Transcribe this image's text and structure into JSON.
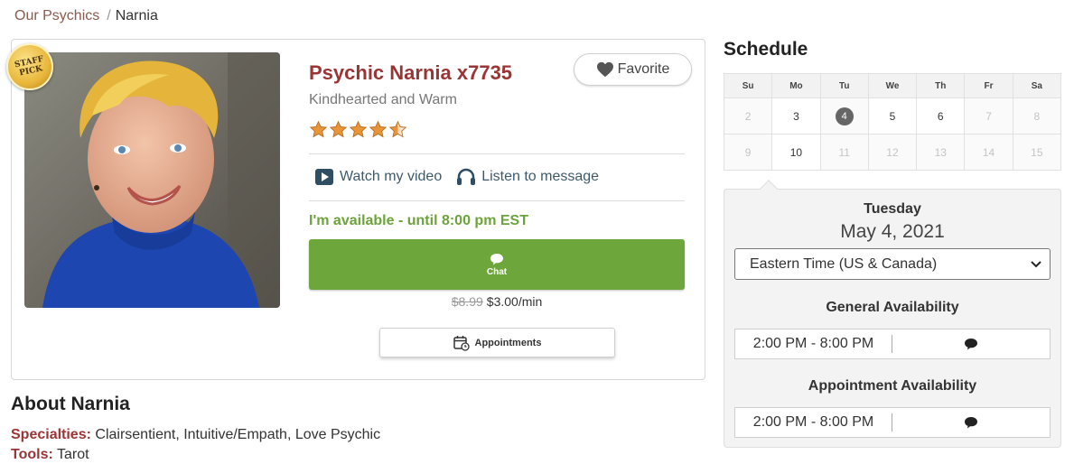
{
  "breadcrumb": {
    "parent": "Our Psychics",
    "separator": "/",
    "current": "Narnia"
  },
  "profile": {
    "badge": "STAFF\nPICK",
    "name": "Psychic Narnia x7735",
    "tagline": "Kindhearted and Warm",
    "rating": 4.5,
    "favorite_label": "Favorite",
    "watch_video_label": "Watch my video",
    "listen_message_label": "Listen to message",
    "availability_text": "I'm available - until 8:00 pm EST",
    "chat_label": "Chat",
    "old_price": "$8.99",
    "price": "$3.00/min",
    "appointments_label": "Appointments"
  },
  "about": {
    "title": "About Narnia",
    "specialties_label": "Specialties:",
    "specialties": "Clairsentient, Intuitive/Empath, Love Psychic",
    "tools_label": "Tools:",
    "tools": "Tarot"
  },
  "schedule": {
    "title": "Schedule",
    "weekdays": [
      "Su",
      "Mo",
      "Tu",
      "We",
      "Th",
      "Fr",
      "Sa"
    ],
    "week1": [
      "2",
      "3",
      "4",
      "5",
      "6",
      "7",
      "8"
    ],
    "week2": [
      "9",
      "10",
      "11",
      "12",
      "13",
      "14",
      "15"
    ],
    "selected_day": "4",
    "selected_weekday": "Tuesday",
    "selected_date": "May 4, 2021",
    "timezone": "Eastern Time (US & Canada)",
    "general_heading": "General Availability",
    "general_slot": "2:00 PM - 8:00 PM",
    "appointment_heading": "Appointment Availability",
    "appointment_slot": "2:00 PM - 8:00 PM"
  },
  "colors": {
    "brand_red": "#9b3435",
    "available_green": "#6da33b",
    "chat_green": "#6da73b",
    "star": "#e8953a"
  }
}
